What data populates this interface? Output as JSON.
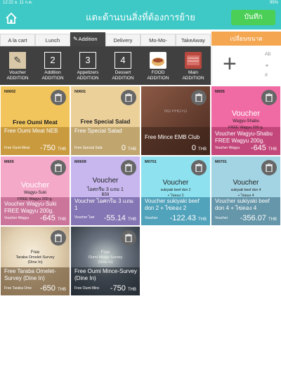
{
  "status": {
    "left": "12:22   อ. 11 ก.ค.",
    "right": "95%"
  },
  "header": {
    "title": "แตะด้านบนสิ่งที่ต้องการย้าย",
    "save_label": "บันทึก"
  },
  "tabs": [
    {
      "label": "A la cart"
    },
    {
      "label": "Lunch"
    },
    {
      "label": "Addition"
    },
    {
      "label": "Delivery"
    },
    {
      "label": "Mo-Mo-Deliv..."
    },
    {
      "label": "TakeAway"
    }
  ],
  "right_button": "เปลี่ยนขนาด",
  "categories": [
    {
      "label": "Voucher\nADDITION",
      "mark": "✎"
    },
    {
      "label": "Addition\nADDITION",
      "mark": "2"
    },
    {
      "label": "Appetizers\nADDITION",
      "mark": "3"
    },
    {
      "label": "Dessert\nADDITION",
      "mark": "4"
    },
    {
      "label": "FOOD\nADDITION",
      "mark": ""
    },
    {
      "label": "Main\nADDITION",
      "mark": ""
    }
  ],
  "tools": {
    "plus": "+",
    "ab": "Ab",
    "hash": "#"
  },
  "cards": [
    {
      "code": "N0602",
      "headline": "Free Oumi Meat",
      "name": "Free Oumi Meat NEB",
      "sub": "Free Oumi Meat",
      "price": "-750",
      "currency": "THB",
      "color": "#f2c55c",
      "band": "#c99a3e"
    },
    {
      "code": "N0601",
      "headline": "Free Special Salad",
      "name": "Free Special Salad",
      "sub": "Free Special Salad",
      "price": "0",
      "currency": "THB",
      "color": "#ecd09a",
      "band": "#c0a56f"
    },
    {
      "code": "",
      "headline": "NO PHOTO",
      "name": "Free Mince EMB Club",
      "sub": "",
      "price": "0",
      "currency": "THB",
      "color": "#7a4a3a",
      "band": "#5a3528"
    },
    {
      "code": "M605",
      "headline": "Voucher",
      "line2": "Wagyu-Shabu",
      "line3": "FREE Wagyu 200 g.",
      "name": "Voucher Wagyu-Shabu FREE Wagyu 200g.",
      "sub": "Voucher Wagyu",
      "price": "-645",
      "currency": "THB",
      "color": "#f06aa3",
      "band": "#c64f83"
    },
    {
      "code": "M605",
      "headline": "Voucher",
      "line2": "Wagyu-Suki",
      "line3": "FREE Wagyu 200 g.",
      "name": "Voucher Wagyu-Suki FREE Wagyu 200g.",
      "sub": "Voucher Wagyu",
      "price": "-645",
      "currency": "THB",
      "color": "#f5a9c8",
      "band": "#c7789a"
    },
    {
      "code": "M0609",
      "headline": "Voucher",
      "line2": "ไอศกรีม 3 แถม 1",
      "line3": "B59",
      "name": "Voucher ไอศกรีม 3 แถม 1",
      "sub": "Voucher ไอศ",
      "price": "-55.14",
      "currency": "THB",
      "color": "#c7b7ee",
      "band": "#9686c0"
    },
    {
      "code": "M0701",
      "headline": "Voucher",
      "line2": "sukiyaki beef don 2",
      "line3": "+ ไข่ดอง 2",
      "name": "Voucher sukiyaki beef don 2 + ไข่ดอง 2",
      "sub": "Voucher",
      "price": "-122.43",
      "currency": "THB",
      "color": "#8ee2f0",
      "band": "#5cb3c4"
    },
    {
      "code": "M0701",
      "headline": "Voucher",
      "line2": "sukiyaki beef don 4",
      "line3": "+ ไข่ดอง 4",
      "name": "Voucher sukiyaki beef don 4 + ไข่ดอง 4",
      "sub": "Voucher",
      "price": "-356.07",
      "currency": "THB",
      "color": "#a3d4e4",
      "band": "#6fa6b8"
    },
    {
      "code": "",
      "headline": "Free",
      "line2": "Taraba Omelet-Survey",
      "line3": "(Dine In)",
      "name": "Free Taraba Omelet-Survey (Dine In)",
      "sub": "Free Taraba Ome",
      "price": "-650",
      "currency": "THB",
      "color": "#e9dcc6",
      "band": "#a8937a"
    },
    {
      "code": "",
      "headline": "Free",
      "line2": "Oumi Mince-Survey",
      "line3": "(Dine In)",
      "name": "Free Oumi Mince-Survey (Dine In)",
      "sub": "Free Oumi Minc",
      "price": "-750",
      "currency": "THB",
      "color": "#3a4450",
      "band": "#2a323b"
    }
  ]
}
